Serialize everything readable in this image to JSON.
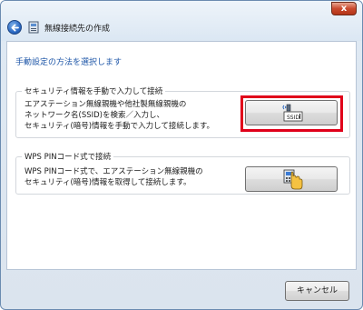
{
  "window": {
    "title": "無線接続先の作成",
    "close_label": "x"
  },
  "main": {
    "instruction": "手動設定の方法を選択します",
    "manual_group": {
      "legend": "セキュリティ情報を手動で入力して接続",
      "description": [
        "エアステーション無線親機や他社製無線親機の",
        "ネットワーク名(SSID)を検索／入力し、",
        "セキュリティ(暗号)情報を手動で入力して接続します。"
      ],
      "button_icon_text": "SSID",
      "highlight_color": "#e0001a"
    },
    "wps_group": {
      "legend": "WPS PINコード式で接続",
      "description": [
        "WPS PINコード式で、エアステーション無線親機の",
        "セキュリティ(暗号)情報を取得して接続します。"
      ]
    }
  },
  "footer": {
    "cancel_label": "キャンセル"
  },
  "icons": {
    "back": "back-arrow-icon",
    "wifi": "wireless-network-icon",
    "ssid_entry": "ssid-keyboard-icon",
    "wps_pin": "wps-pin-hand-icon"
  },
  "colors": {
    "accent": "#1f57a8",
    "close": "#c94a2e"
  }
}
